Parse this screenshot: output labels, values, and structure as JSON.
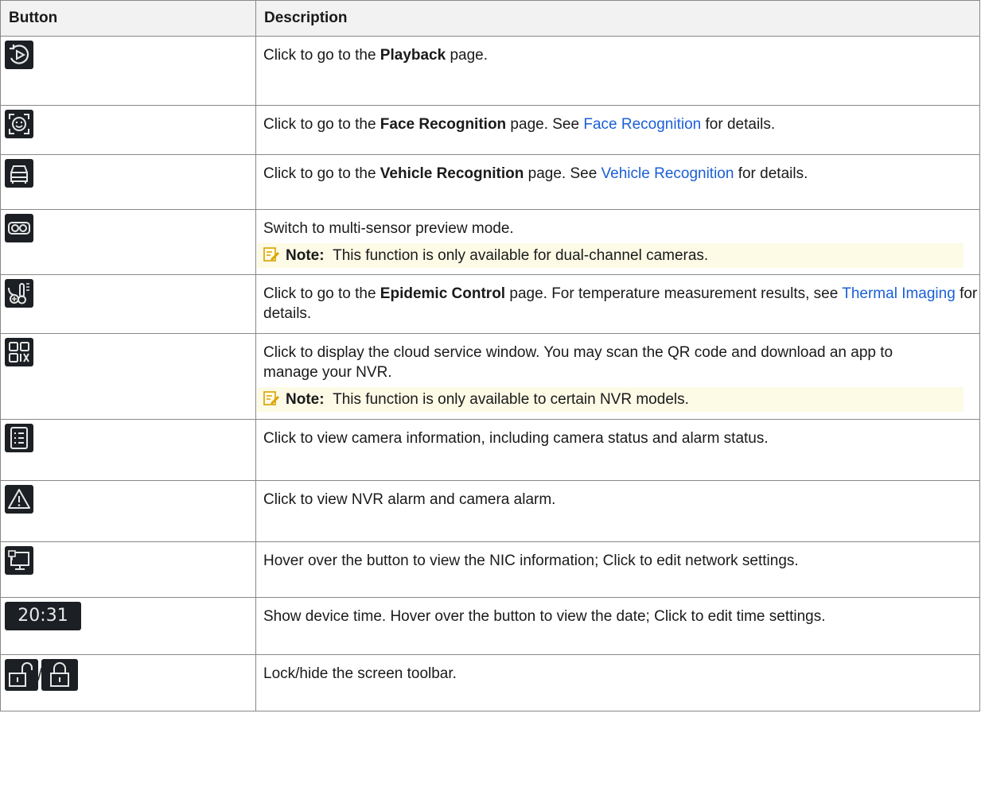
{
  "table": {
    "header_button": "Button",
    "header_description": "Description",
    "rows": [
      {
        "icon": "playback-icon",
        "desc_pre": "Click to go to the ",
        "desc_bold": "Playback",
        "desc_post": " page."
      },
      {
        "icon": "face-recognition-icon",
        "desc_pre": "Click to go to the ",
        "desc_bold": "Face Recognition",
        "desc_mid": " page. See ",
        "link": "Face Recognition",
        "desc_post": " for details."
      },
      {
        "icon": "vehicle-recognition-icon",
        "desc_pre": "Click to go to the ",
        "desc_bold": "Vehicle Recognition",
        "desc_mid": " page. See ",
        "link": "Vehicle Recognition",
        "desc_post": " for details."
      },
      {
        "icon": "multi-sensor-icon",
        "desc": "Switch to multi-sensor preview mode.",
        "note_label": "Note:",
        "note_text": "This function is only available for dual-channel cameras."
      },
      {
        "icon": "epidemic-control-icon",
        "desc_pre": "Click to go to the ",
        "desc_bold": "Epidemic Control",
        "desc_mid": " page. For temperature measurement results, see ",
        "link": "Thermal Imaging",
        "desc_post": " for details."
      },
      {
        "icon": "qr-code-icon",
        "desc": "Click to display the cloud service window. You may scan the QR code and download an app to manage your NVR.",
        "note_label": "Note:",
        "note_text": "This function is only available to certain NVR models."
      },
      {
        "icon": "camera-list-icon",
        "desc": "Click to view camera information, including camera status and alarm status."
      },
      {
        "icon": "alarm-warning-icon",
        "desc": "Click to view NVR alarm and camera alarm."
      },
      {
        "icon": "network-icon",
        "desc": "Hover over the button to view the NIC information; Click to edit network settings."
      },
      {
        "icon": "time-display",
        "time": "20:31",
        "desc": "Show device time. Hover over the button to view the date; Click to edit time settings."
      },
      {
        "icon": "lock-icons",
        "separator": "/",
        "desc": "Lock/hide the screen toolbar."
      }
    ]
  }
}
